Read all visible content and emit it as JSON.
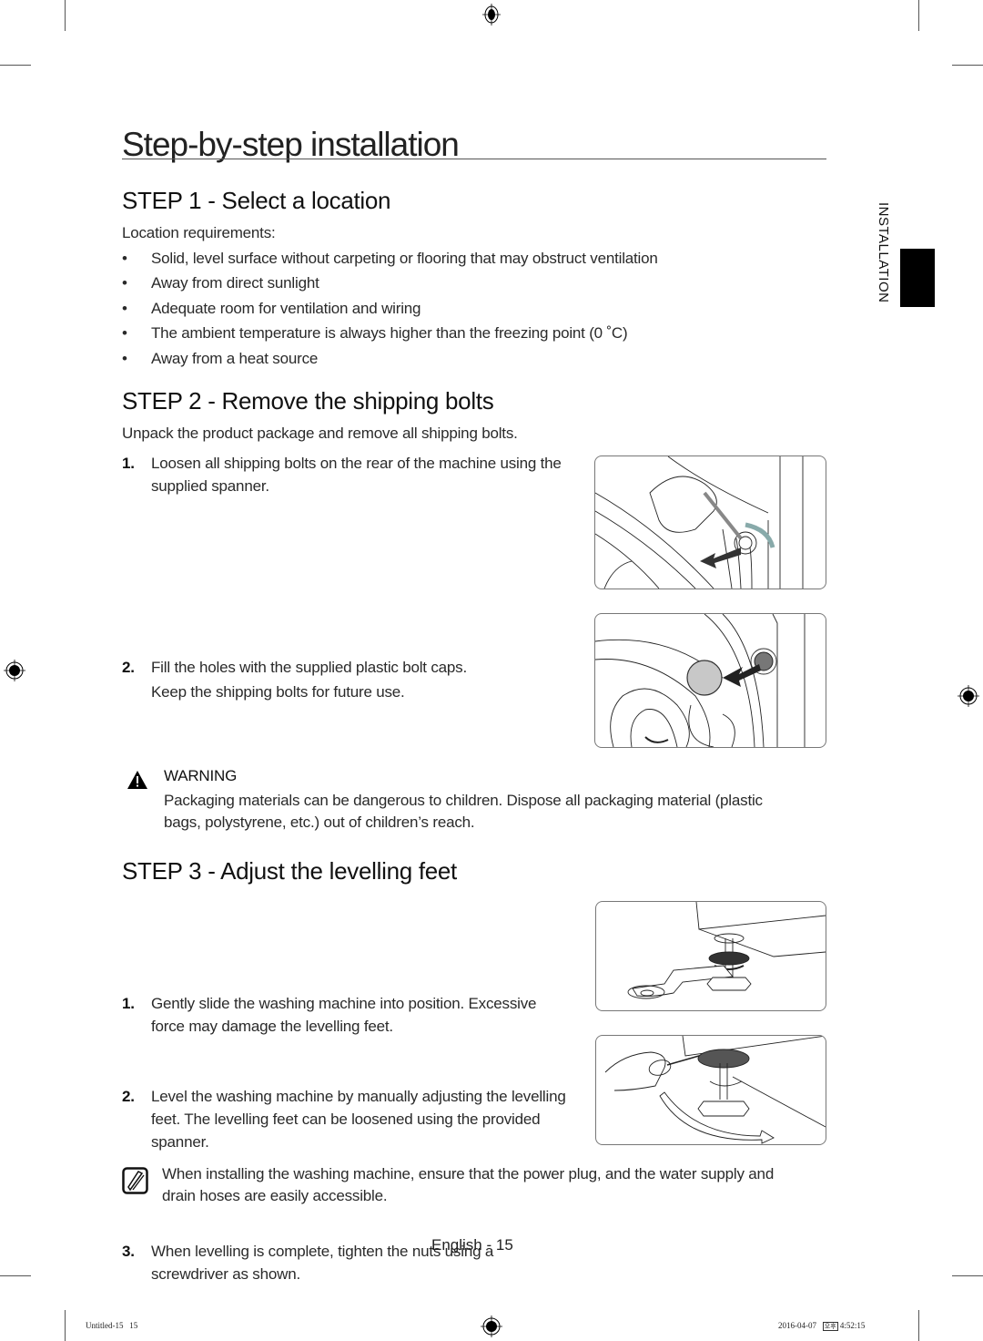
{
  "page": {
    "title": "Step-by-step installation",
    "side_tab": "INSTALLATION",
    "page_label": "English - 15"
  },
  "step1": {
    "heading": "STEP 1 - Select a location",
    "intro": "Location requirements:",
    "bullets": [
      "Solid, level surface without carpeting or flooring that may obstruct ventilation",
      "Away from direct sunlight",
      "Adequate room for ventilation and wiring",
      "The ambient temperature is always higher than the freezing point (0 ˚C)",
      "Away from a heat source"
    ],
    "bullet_glyph": "•"
  },
  "step2": {
    "heading": "STEP 2 - Remove the shipping bolts",
    "intro": "Unpack the product package and remove all shipping bolts.",
    "items": [
      {
        "num": "1.",
        "lines": [
          "Loosen all shipping bolts on the rear of the machine using the",
          "supplied spanner."
        ]
      },
      {
        "num": "2.",
        "lines": [
          "Fill the holes with the supplied plastic bolt caps.",
          "Keep the shipping bolts for future use."
        ]
      }
    ]
  },
  "warning": {
    "title": "WARNING",
    "text_lines": [
      "Packaging materials can be dangerous to children. Dispose all packaging material (plastic",
      "bags, polystyrene, etc.) out of children’s reach."
    ]
  },
  "step3": {
    "heading": "STEP 3 - Adjust the levelling feet",
    "items": [
      {
        "num": "1.",
        "lines": [
          "Gently slide the washing machine into position. Excessive",
          "force may damage the levelling feet."
        ]
      },
      {
        "num": "2.",
        "lines": [
          "Level the washing machine by manually adjusting the levelling",
          "feet. The levelling feet can be loosened using the provided",
          "spanner."
        ]
      },
      {
        "num": "3.",
        "lines": [
          "When levelling is complete, tighten the nuts using a",
          "screwdriver as shown."
        ]
      }
    ]
  },
  "note": {
    "text_lines": [
      "When installing the washing machine, ensure that the power plug, and the water supply and",
      "drain hoses are easily accessible."
    ]
  },
  "print_footer": {
    "file": "Untitled-15   15",
    "date": "2016-04-07",
    "ampm_glyph": "오후",
    "time": "4:52:15"
  }
}
